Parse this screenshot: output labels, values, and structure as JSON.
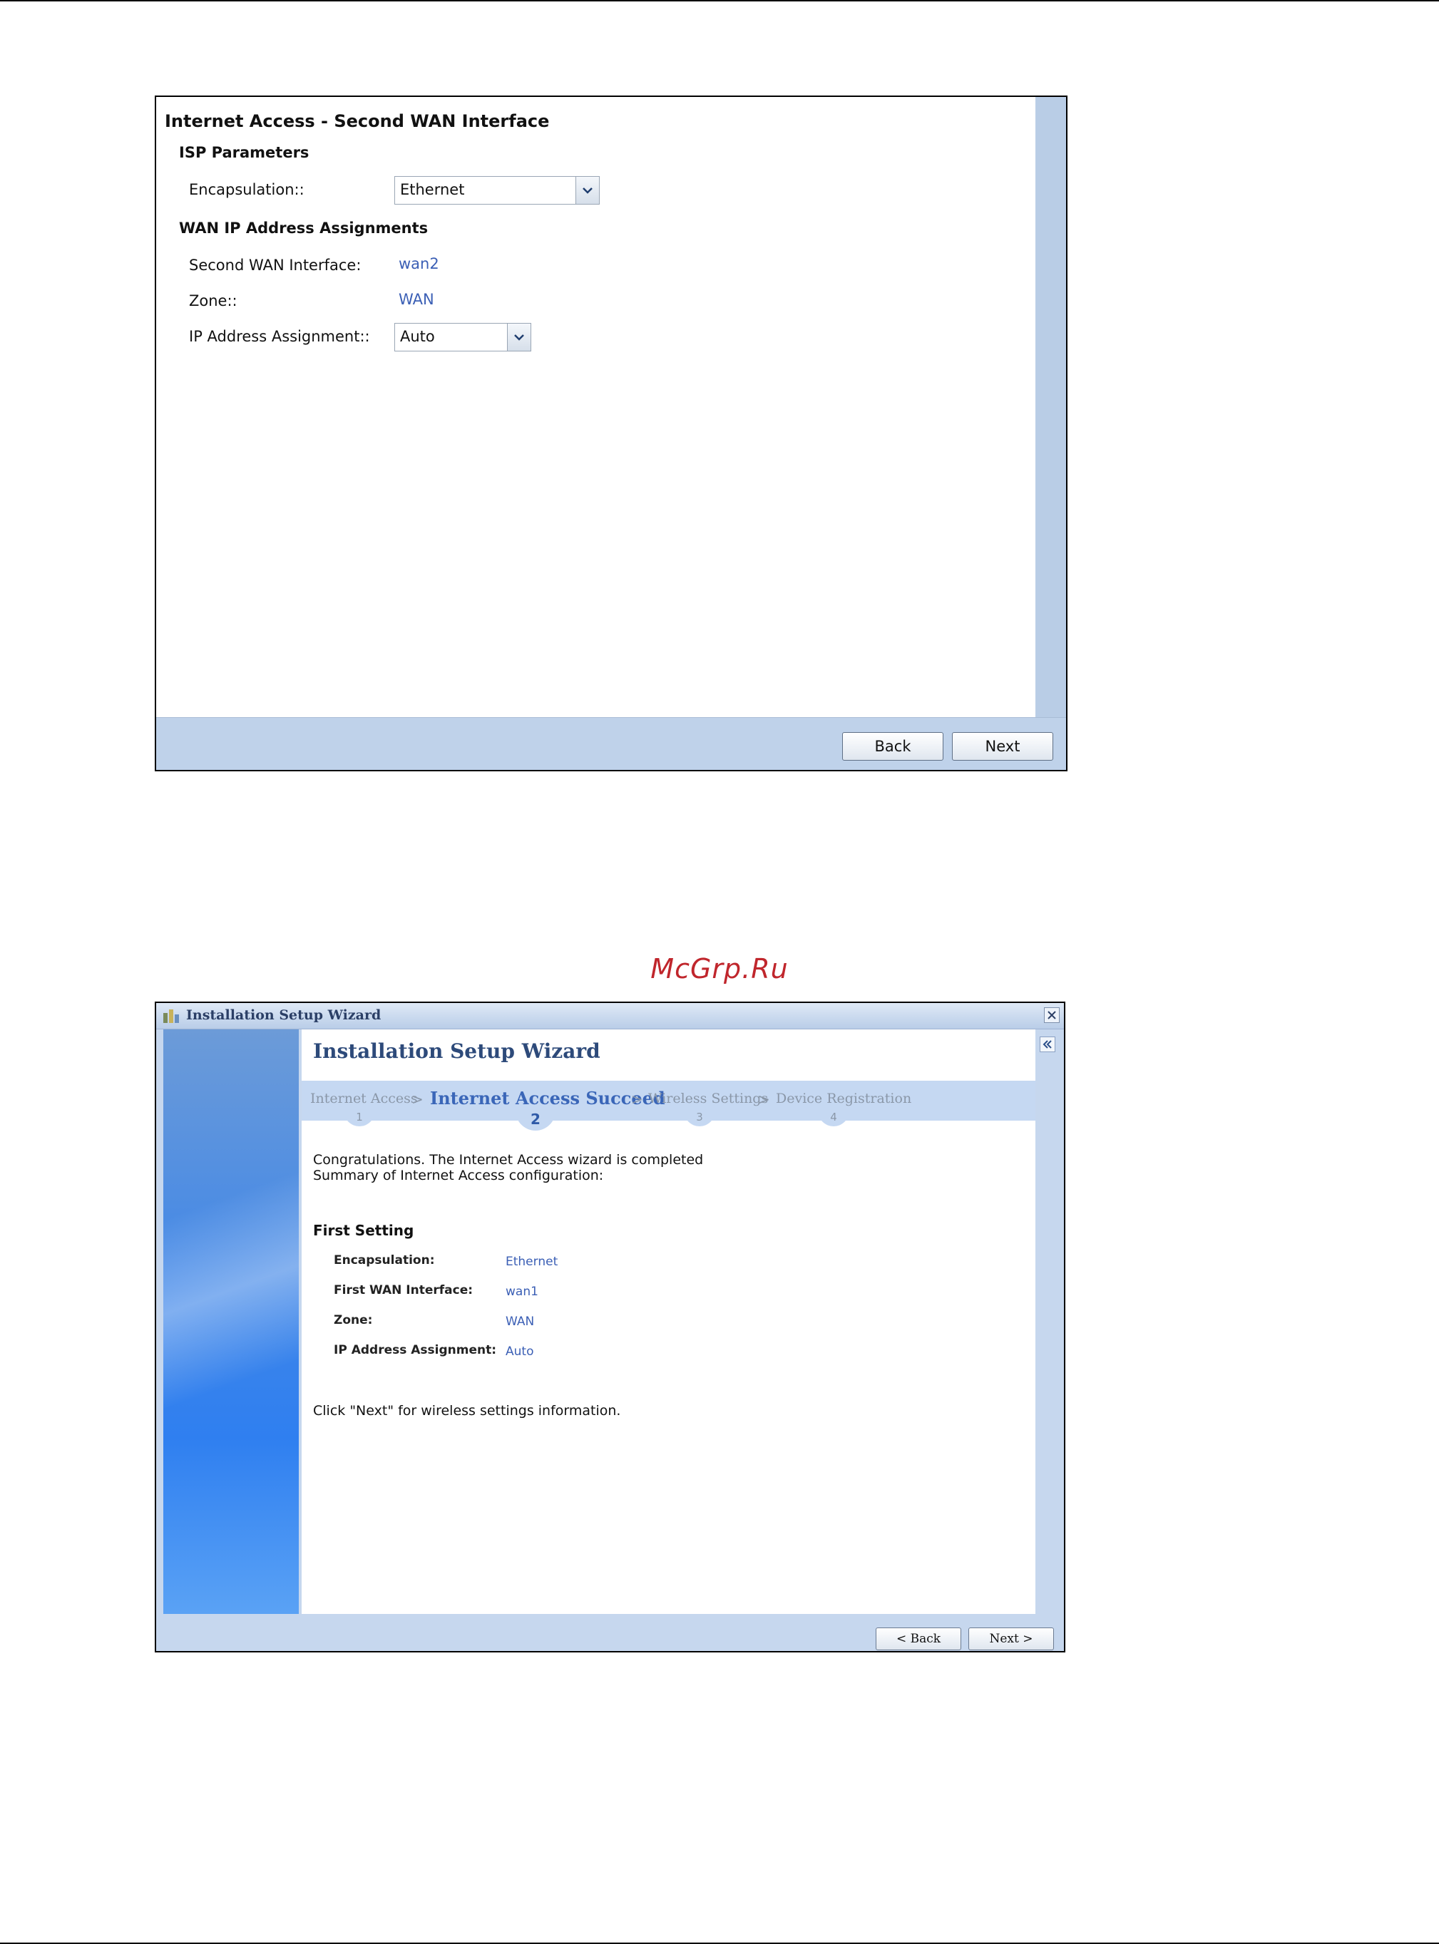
{
  "screen1": {
    "title": "Internet Access - Second WAN Interface",
    "isp_section": "ISP Parameters",
    "encapsulation_label": "Encapsulation::",
    "encapsulation_value": "Ethernet",
    "wan_section": "WAN IP Address Assignments",
    "second_wan_label": "Second WAN Interface:",
    "second_wan_value": "wan2",
    "zone_label": "Zone::",
    "zone_value": "WAN",
    "ip_assign_label": "IP Address Assignment::",
    "ip_assign_value": "Auto",
    "back_label": "Back",
    "next_label": "Next"
  },
  "watermark": "McGrp.Ru",
  "screen2": {
    "window_title": "Installation Setup Wizard",
    "wizard_title": "Installation Setup Wizard",
    "steps": [
      {
        "label": "Internet Access",
        "number": "1"
      },
      {
        "label": "Internet Access Succeed",
        "number": "2"
      },
      {
        "label": "Wireless Settings",
        "number": "3"
      },
      {
        "label": "Device Registration",
        "number": "4"
      }
    ],
    "message_line1": "Congratulations. The Internet Access wizard is completed",
    "message_line2": "Summary of Internet Access configuration:",
    "section_title": "First Setting",
    "rows": [
      {
        "label": "Encapsulation:",
        "value": "Ethernet"
      },
      {
        "label": "First WAN Interface:",
        "value": "wan1"
      },
      {
        "label": "Zone:",
        "value": "WAN"
      },
      {
        "label": "IP Address Assignment:",
        "value": "Auto"
      }
    ],
    "footer_note": "Click \"Next\" for wireless settings information.",
    "back_label": "< Back",
    "next_label": "Next >"
  },
  "colors": {
    "link_value": "#3b5fb5",
    "panel_blue": "#bfd2ea",
    "step_active": "#3a66b8",
    "watermark": "#c0262c"
  }
}
